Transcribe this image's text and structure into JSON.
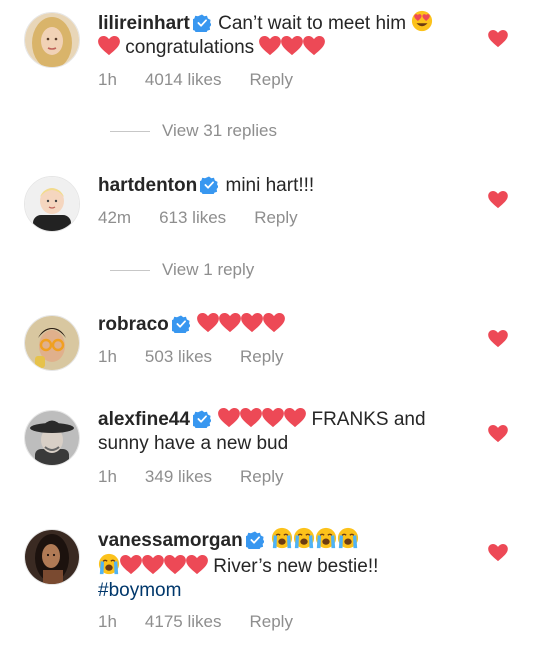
{
  "comments": [
    {
      "username": "lilireinhart",
      "text_line1": "Can’t wait to meet him",
      "text_line2": "congratulations",
      "hearts": 3,
      "time": "1h",
      "likes": "4014 likes",
      "reply": "Reply",
      "avatar": "avatar-woman-blonde"
    },
    {
      "username": "hartdenton",
      "text_line1": "mini hart!!!",
      "time": "42m",
      "likes": "613 likes",
      "reply": "Reply",
      "avatar": "avatar-child-blonde"
    },
    {
      "username": "robraco",
      "hearts": 4,
      "time": "1h",
      "likes": "503 likes",
      "reply": "Reply",
      "avatar": "avatar-man-glasses"
    },
    {
      "username": "alexfine44",
      "hearts": 4,
      "text_line1": "FRANKS and",
      "text_line2": "sunny have a new bud",
      "time": "1h",
      "likes": "349 likes",
      "reply": "Reply",
      "avatar": "avatar-man-hat"
    },
    {
      "username": "vanessamorgan",
      "text_line2": "River’s new bestie!!",
      "hashtag": "#boymom",
      "time": "1h",
      "likes": "4175 likes",
      "reply": "Reply",
      "avatar": "avatar-woman-dark-hair"
    }
  ],
  "view_replies": [
    {
      "label": "View 31 replies"
    },
    {
      "label": "View 1 reply"
    }
  ],
  "icons": {
    "verified": "verified-badge-icon",
    "heart": "red-heart-icon",
    "heart_eyes": "heart-eyes-emoji",
    "crying": "loudly-crying-emoji",
    "like": "like-heart-icon"
  },
  "colors": {
    "heart_red": "#ed4956",
    "verified_blue": "#3897f0",
    "meta_gray": "#8e8e8e",
    "hashtag_blue": "#00376b"
  }
}
